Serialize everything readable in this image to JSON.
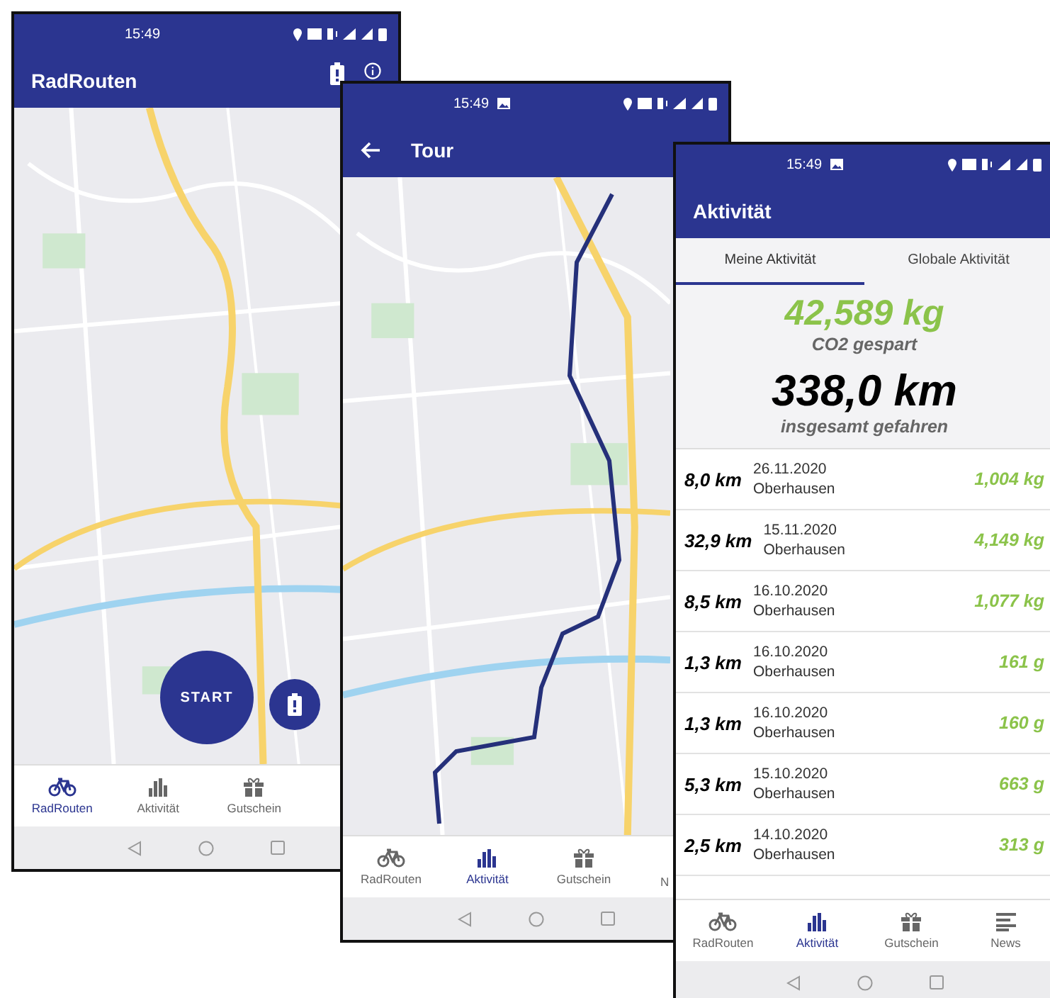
{
  "screens": [
    {
      "kind": "home",
      "status_time": "15:49",
      "title": "RadRouten",
      "start_button": "START",
      "nav": [
        {
          "label": "RadRouten",
          "selected": true
        },
        {
          "label": "Aktivität",
          "selected": false
        },
        {
          "label": "Gutschein",
          "selected": false
        }
      ]
    },
    {
      "kind": "tour",
      "status_time": "15:49",
      "title": "Tour",
      "nav": [
        {
          "label": "RadRouten",
          "selected": false
        },
        {
          "label": "Aktivität",
          "selected": true
        },
        {
          "label": "Gutschein",
          "selected": false
        },
        {
          "label": "N",
          "selected": false
        }
      ]
    },
    {
      "kind": "activity",
      "status_time": "15:49",
      "title": "Aktivität",
      "tabs": [
        {
          "label": "Meine Aktivität",
          "selected": true
        },
        {
          "label": "Globale Aktivität",
          "selected": false
        }
      ],
      "co2": {
        "value": "42,589 kg",
        "label": "CO2 gespart"
      },
      "distance": {
        "value": "338,0 km",
        "label": "insgesamt gefahren"
      },
      "trips": [
        {
          "distance": "8,0 km",
          "date": "26.11.2020",
          "place": "Oberhausen",
          "co2": "1,004 kg"
        },
        {
          "distance": "32,9 km",
          "date": "15.11.2020",
          "place": "Oberhausen",
          "co2": "4,149 kg"
        },
        {
          "distance": "8,5 km",
          "date": "16.10.2020",
          "place": "Oberhausen",
          "co2": "1,077 kg"
        },
        {
          "distance": "1,3 km",
          "date": "16.10.2020",
          "place": "Oberhausen",
          "co2": "161 g"
        },
        {
          "distance": "1,3 km",
          "date": "16.10.2020",
          "place": "Oberhausen",
          "co2": "160 g"
        },
        {
          "distance": "5,3 km",
          "date": "15.10.2020",
          "place": "Oberhausen",
          "co2": "663 g"
        },
        {
          "distance": "2,5 km",
          "date": "14.10.2020",
          "place": "Oberhausen",
          "co2": "313 g"
        }
      ],
      "nav": [
        {
          "label": "RadRouten",
          "selected": false
        },
        {
          "label": "Aktivität",
          "selected": true
        },
        {
          "label": "Gutschein",
          "selected": false
        },
        {
          "label": "News",
          "selected": false
        }
      ]
    }
  ]
}
